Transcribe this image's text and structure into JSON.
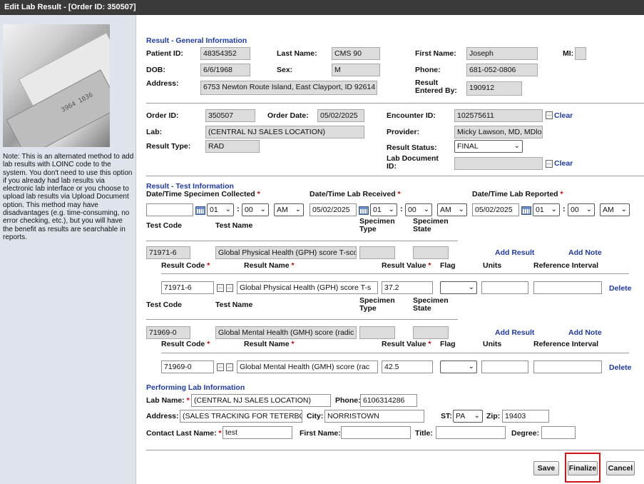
{
  "window": {
    "title": "Edit Lab Result - [Order ID: 350507]"
  },
  "sidebar": {
    "note": "Note: This is an alternated method to add lab results with LOINC code to the system. You don't need to use this option if you already had lab results via electronic lab interface or you choose to upload lab results via Upload Document option. This method may have disadvantages (e.g. time-consuming, no error checking, etc.), but you will have the benefit as results are searchable in reports.",
    "photo_text": "3964 1036"
  },
  "general": {
    "title": "Result - General Information",
    "patient_id_label": "Patient ID:",
    "patient_id": "48354352",
    "last_name_label": "Last Name:",
    "last_name": "CMS 90",
    "first_name_label": "First Name:",
    "first_name": "Joseph",
    "mi_label": "MI:",
    "mi": "",
    "dob_label": "DOB:",
    "dob": "6/6/1968",
    "sex_label": "Sex:",
    "sex": "M",
    "phone_label": "Phone:",
    "phone": "681-052-0806",
    "address_label": "Address:",
    "address": "6753 Newton Route Island, East Clayport, ID 92614",
    "entered_by_label": "Result Entered By:",
    "entered_by": "190912",
    "order_id_label": "Order ID:",
    "order_id": "350507",
    "order_date_label": "Order Date:",
    "order_date": "05/02/2025",
    "encounter_id_label": "Encounter ID:",
    "encounter_id": "102575611",
    "clear_label": "Clear",
    "lab_label": "Lab:",
    "lab": "(CENTRAL NJ SALES LOCATION)",
    "provider_label": "Provider:",
    "provider": "Micky Lawson, MD, MDloc",
    "result_type_label": "Result Type:",
    "result_type": "RAD",
    "result_status_label": "Result Status:",
    "result_status": "FINAL",
    "lab_doc_id_label": "Lab Document ID:",
    "lab_doc_id": ""
  },
  "test": {
    "title": "Result - Test Information",
    "collected_label": "Date/Time Specimen Collected",
    "received_label": "Date/Time Lab Received",
    "reported_label": "Date/Time Lab Reported",
    "collected": {
      "date": "",
      "hour": "01",
      "minute": "00",
      "ampm": "AM"
    },
    "received": {
      "date": "05/02/2025",
      "hour": "01",
      "minute": "00",
      "ampm": "AM"
    },
    "reported": {
      "date": "05/02/2025",
      "hour": "01",
      "minute": "00",
      "ampm": "AM"
    },
    "colon": ":",
    "headers": {
      "test_code": "Test Code",
      "test_name": "Test Name",
      "specimen_type": "Specimen Type",
      "specimen_state": "Specimen State",
      "add_result": "Add Result",
      "add_note": "Add Note",
      "result_code": "Result Code",
      "result_name": "Result Name",
      "result_value": "Result Value",
      "flag": "Flag",
      "units": "Units",
      "reference_interval": "Reference Interval",
      "delete": "Delete"
    },
    "tests": [
      {
        "code": "71971-6",
        "name": "Global Physical Health (GPH) score T-sco",
        "result_code": "71971-6",
        "result_name": "Global Physical Health (GPH) score T-s",
        "result_value": "37.2",
        "flag": "",
        "units": "",
        "reference": ""
      },
      {
        "code": "71969-0",
        "name": "Global Mental Health (GMH) score  (radic",
        "result_code": "71969-0",
        "result_name": "Global Mental Health (GMH) score  (rac",
        "result_value": "42.5",
        "flag": "",
        "units": "",
        "reference": ""
      }
    ]
  },
  "performing": {
    "title": "Performing Lab Information",
    "lab_name_label": "Lab Name:",
    "lab_name": "(CENTRAL NJ SALES LOCATION)",
    "phone_label": "Phone:",
    "phone": "6106314286",
    "address_label": "Address:",
    "address": "(SALES TRACKING FOR TETERBOR",
    "city_label": "City:",
    "city": "NORRISTOWN",
    "st_label": "ST:",
    "st": "PA",
    "zip_label": "Zip:",
    "zip": "19403",
    "contact_last_label": "Contact Last Name:",
    "contact_last": "test",
    "first_name_label": "First Name:",
    "first_name": "",
    "title_label": "Title:",
    "title_value": "",
    "degree_label": "Degree:",
    "degree": ""
  },
  "footer": {
    "save": "Save",
    "finalize": "Finalize",
    "cancel": "Cancel"
  },
  "colors": {
    "section_title": "#1f3aa8",
    "highlight": "#d6121a",
    "required": "#d00000"
  }
}
